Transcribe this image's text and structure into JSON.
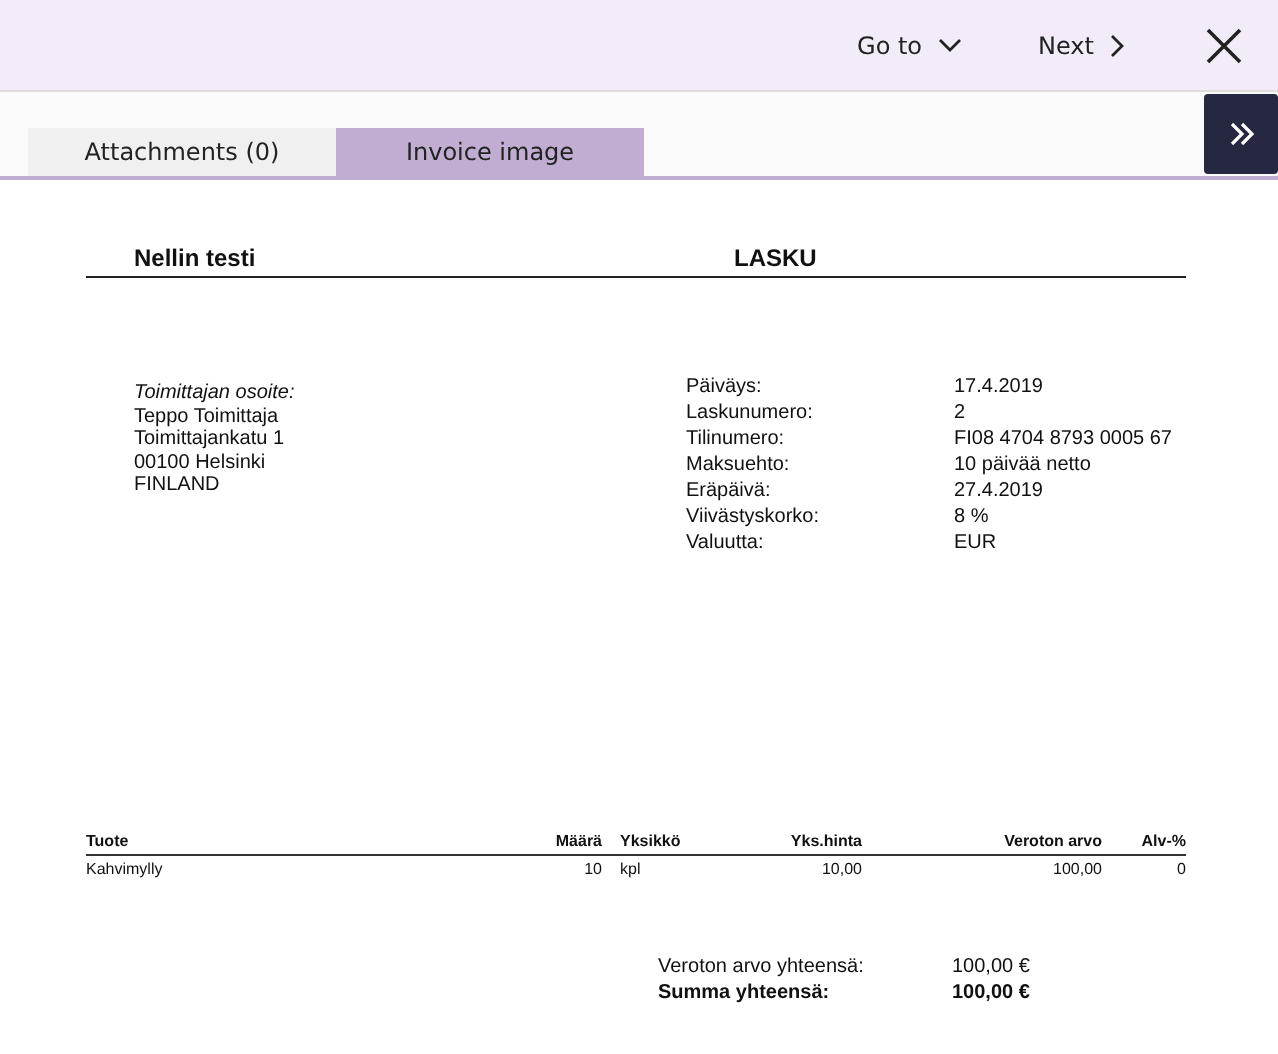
{
  "toolbar": {
    "goto": "Go to",
    "next": "Next"
  },
  "tabs": [
    {
      "label": "Attachments (0)",
      "selected": false
    },
    {
      "label": "Invoice image",
      "selected": true
    }
  ],
  "invoice": {
    "company": "Nellin testi",
    "title": "LASKU",
    "address_label": "Toimittajan osoite:",
    "address_lines": [
      "Teppo Toimittaja",
      "Toimittajankatu 1",
      "00100 Helsinki",
      "FINLAND"
    ],
    "details": [
      {
        "label": "Päiväys:",
        "value": "17.4.2019"
      },
      {
        "label": "Laskunumero:",
        "value": "2"
      },
      {
        "label": "Tilinumero:",
        "value": "FI08 4704 8793 0005 67"
      },
      {
        "label": "Maksuehto:",
        "value": "10 päivää netto"
      },
      {
        "label": "Eräpäivä:",
        "value": "27.4.2019"
      },
      {
        "label": "Viivästyskorko:",
        "value": "8 %"
      },
      {
        "label": "Valuutta:",
        "value": "EUR"
      }
    ],
    "table": {
      "columns": [
        "Tuote",
        "Määrä",
        "Yksikkö",
        "Yks.hinta",
        "Veroton arvo",
        "Alv-%"
      ],
      "rows": [
        [
          "Kahvimylly",
          "10",
          "kpl",
          "10,00",
          "100,00",
          "0"
        ]
      ]
    },
    "totals": [
      {
        "label": "Veroton arvo yhteensä:",
        "value": "100,00 €",
        "bold": false
      },
      {
        "label": "Summa yhteensä:",
        "value": "100,00 €",
        "bold": true
      }
    ]
  }
}
